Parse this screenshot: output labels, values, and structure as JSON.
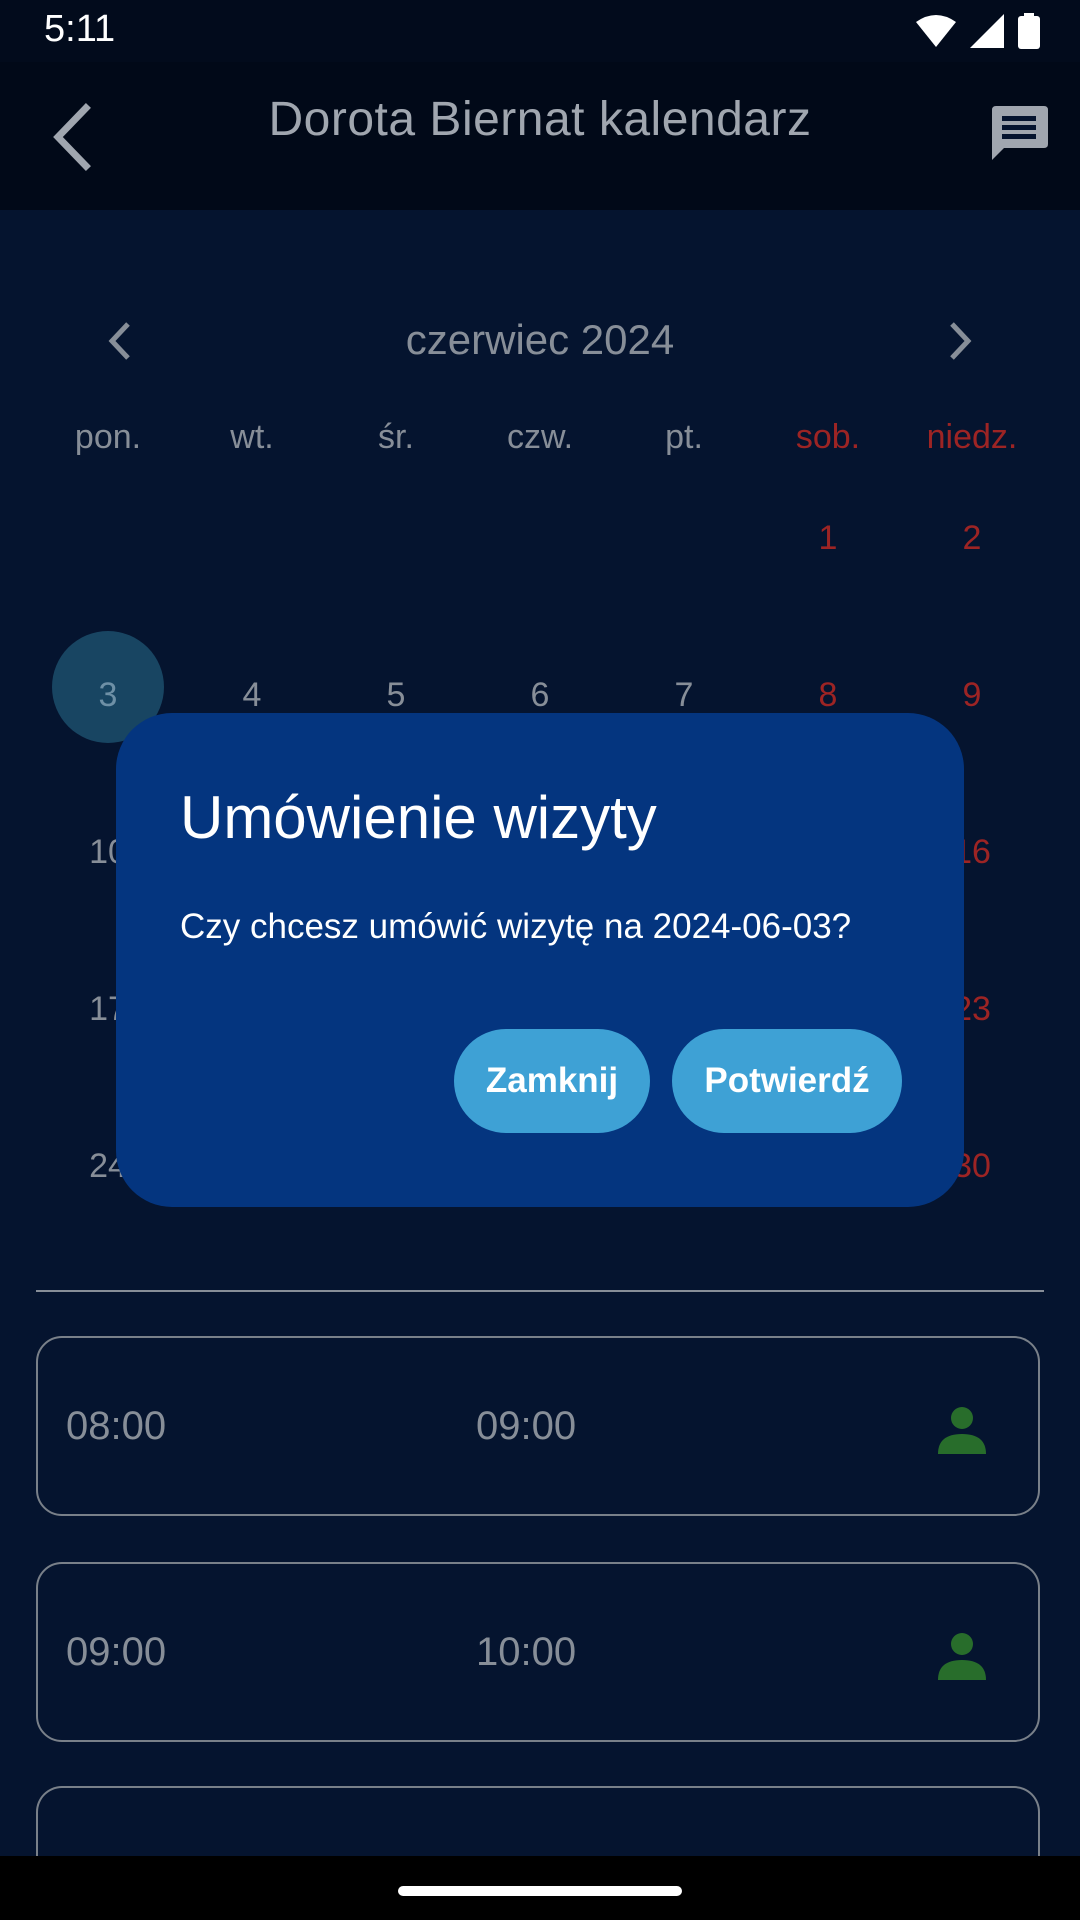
{
  "status_bar": {
    "time": "5:11"
  },
  "app_bar": {
    "title": "Dorota Biernat  kalendarz"
  },
  "calendar": {
    "month_label": "czerwiec 2024",
    "weekdays": [
      "pon.",
      "wt.",
      "śr.",
      "czw.",
      "pt.",
      "sob.",
      "niedz."
    ],
    "weeks": [
      [
        "",
        "",
        "",
        "",
        "",
        "1",
        "2"
      ],
      [
        "3",
        "4",
        "5",
        "6",
        "7",
        "8",
        "9"
      ],
      [
        "10",
        "",
        "",
        "",
        "",
        "",
        "16"
      ],
      [
        "17",
        "",
        "",
        "",
        "",
        "",
        "23"
      ],
      [
        "24",
        "",
        "",
        "",
        "",
        "",
        "30"
      ]
    ],
    "selected_day": "3"
  },
  "slots": [
    {
      "start": "08:00",
      "end": "09:00"
    },
    {
      "start": "09:00",
      "end": "10:00"
    }
  ],
  "dialog": {
    "title": "Umówienie wizyty",
    "message": "Czy chcesz umówić wizytę na 2024-06-03?",
    "close_label": "Zamknij",
    "confirm_label": "Potwierdź"
  },
  "colors": {
    "background": "#061736",
    "dialog": "#04357f",
    "button": "#3ea1d5",
    "weekend": "#b32a2a",
    "person_icon": "#2e7d32"
  }
}
